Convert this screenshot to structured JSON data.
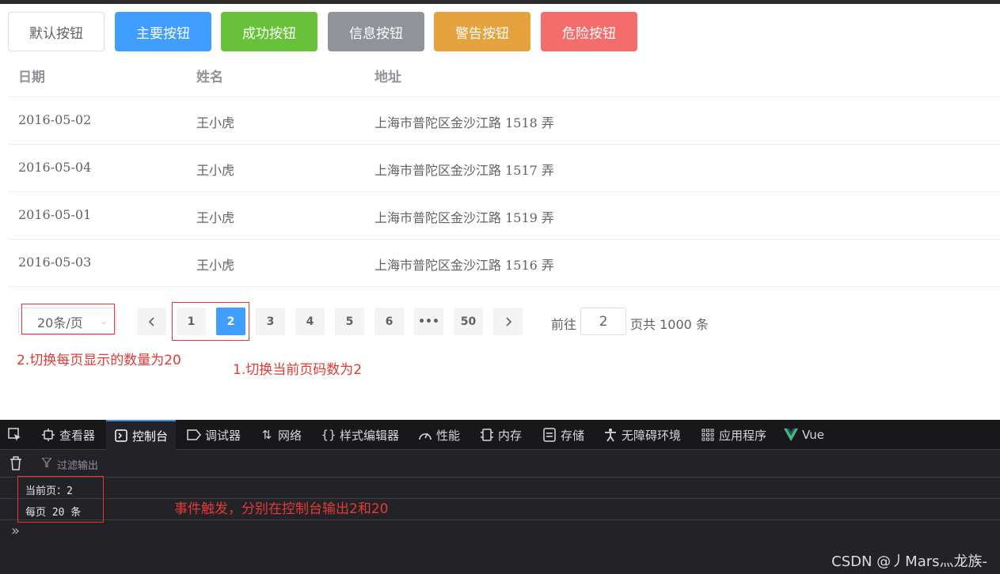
{
  "buttons": {
    "default": "默认按钮",
    "primary": "主要按钮",
    "success": "成功按钮",
    "info": "信息按钮",
    "warning": "警告按钮",
    "danger": "危险按钮"
  },
  "table": {
    "headers": [
      "日期",
      "姓名",
      "地址"
    ],
    "rows": [
      [
        "2016-05-02",
        "王小虎",
        "上海市普陀区金沙江路 1518 弄"
      ],
      [
        "2016-05-04",
        "王小虎",
        "上海市普陀区金沙江路 1517 弄"
      ],
      [
        "2016-05-01",
        "王小虎",
        "上海市普陀区金沙江路 1519 弄"
      ],
      [
        "2016-05-03",
        "王小虎",
        "上海市普陀区金沙江路 1516 弄"
      ]
    ]
  },
  "pagination": {
    "page_size": "20条/页",
    "prev_icon": "chevron-left-icon",
    "pages": [
      "1",
      "2",
      "3",
      "4",
      "5",
      "6",
      "•••",
      "50"
    ],
    "current_page": "2",
    "next_icon": "chevron-right-icon",
    "goto_prefix": "前往",
    "goto_value": "2",
    "goto_suffix": "页",
    "total": "共 1000 条"
  },
  "annotations": {
    "size_note": "2.切换每页显示的数量为20",
    "page_note": "1.切换当前页码数为2",
    "console_note": "事件触发，分别在控制台输出2和20"
  },
  "devtools": {
    "tabs": [
      {
        "label": "查看器",
        "icon": "inspector-icon"
      },
      {
        "label": "控制台",
        "icon": "console-icon"
      },
      {
        "label": "调试器",
        "icon": "debugger-icon"
      },
      {
        "label": "网络",
        "icon": "network-icon"
      },
      {
        "label": "样式编辑器",
        "icon": "style-editor-icon"
      },
      {
        "label": "性能",
        "icon": "performance-icon"
      },
      {
        "label": "内存",
        "icon": "memory-icon"
      },
      {
        "label": "存储",
        "icon": "storage-icon"
      },
      {
        "label": "无障碍环境",
        "icon": "accessibility-icon"
      },
      {
        "label": "应用程序",
        "icon": "application-icon"
      },
      {
        "label": "Vue",
        "icon": "vue-icon"
      }
    ],
    "selected_tab": "控制台",
    "filter_placeholder": "过滤输出",
    "console_lines": [
      "当前页：2",
      "每页 20 条"
    ],
    "colors": {
      "accent": "#3d8bf7",
      "background": "#232327"
    }
  },
  "watermark": "CSDN @丿Mars灬龙族-",
  "colors": {
    "primary": "#409eff",
    "success": "#67c23a",
    "info": "#909399",
    "warning": "#e6a23c",
    "danger": "#f56c6c",
    "annotation_red": "#e53935"
  }
}
